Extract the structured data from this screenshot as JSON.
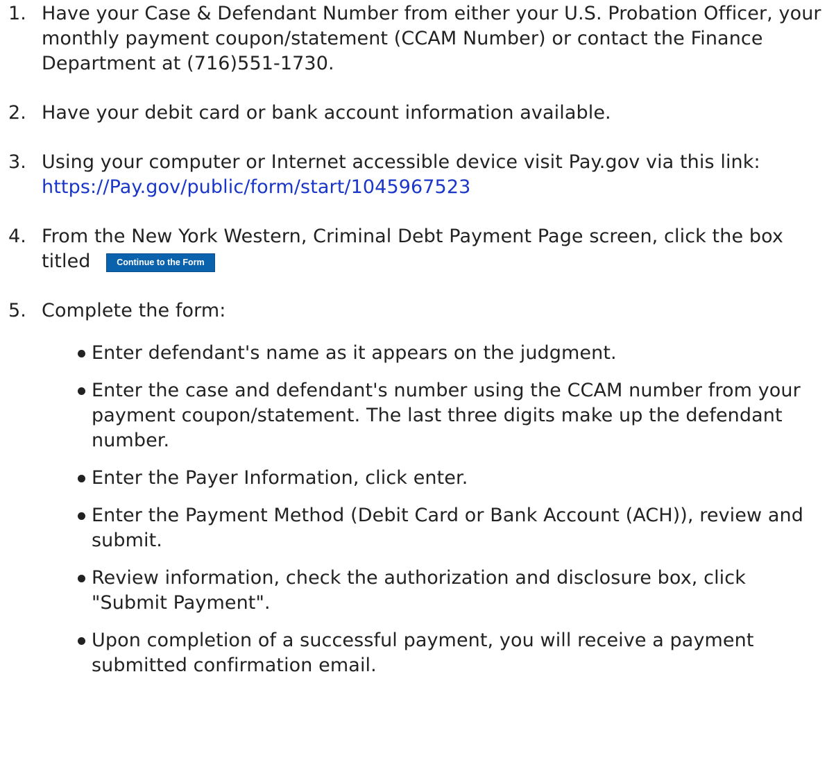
{
  "steps": [
    {
      "number": "1.",
      "text": "Have your Case & Defendant Number from either your U.S. Probation Officer, your monthly payment coupon/statement (CCAM Number) or contact the Finance Department at (716)551-1730."
    },
    {
      "number": "2.",
      "text": "Have your debit card or bank account information available."
    },
    {
      "number": "3.",
      "text": "Using your computer or Internet accessible device visit Pay.gov via this link:",
      "link_text": "https://Pay.gov/public/form/start/1045967523"
    },
    {
      "number": "4.",
      "text": "From the New York Western, Criminal Debt Payment Page screen, click the box titled",
      "button_label": "Continue to the Form"
    },
    {
      "number": "5.",
      "text": "Complete the form:",
      "bullets": [
        "Enter defendant's name as it appears on the judgment.",
        "Enter the case and defendant's number using the CCAM number from your payment coupon/statement. The last three digits make up the defendant number.",
        "Enter the Payer Information, click enter.",
        "Enter the Payment Method (Debit Card or Bank Account (ACH)), review and submit.",
        "Review information, check the authorization and disclosure box, click \"Submit Payment\".",
        "Upon completion of a successful payment, you will receive a payment submitted confirmation email."
      ]
    }
  ],
  "colors": {
    "text": "#222222",
    "link": "#1a36c8",
    "button_bg": "#0a62ad",
    "button_text": "#ffffff"
  }
}
